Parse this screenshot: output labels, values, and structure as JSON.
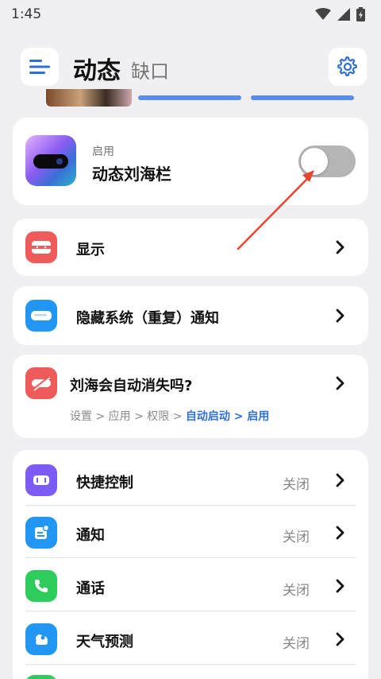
{
  "status_bar": {
    "time": "1:45",
    "icons": [
      "wifi-icon",
      "signal-icon",
      "battery-icon"
    ]
  },
  "header": {
    "title": "动态",
    "subtitle": "缺口",
    "menu_icon": "menu-icon",
    "settings_icon": "gear-icon"
  },
  "enable_card": {
    "small_label": "启用",
    "main_label": "动态刘海栏",
    "toggle_on": false
  },
  "menu": {
    "display": {
      "label": "显示"
    },
    "hide_notifications": {
      "label": "隐藏系统（重复）通知"
    },
    "auto_disappear": {
      "label": "刘海会自动消失吗?",
      "path_plain": "设置 > 应用 > 权限 > ",
      "path_highlight": "自动启动 > 启用"
    }
  },
  "features": [
    {
      "label": "快捷控制",
      "state": "关闭",
      "icon": "quick-control-icon",
      "color": "#7c5cf5"
    },
    {
      "label": "通知",
      "state": "关闭",
      "icon": "notification-icon",
      "color": "#2196f3"
    },
    {
      "label": "通话",
      "state": "关闭",
      "icon": "phone-icon",
      "color": "#2ecc5a"
    },
    {
      "label": "天气预测",
      "state": "关闭",
      "icon": "weather-icon",
      "color": "#2196f3"
    }
  ],
  "colors": {
    "accent_blue": "#2f6fd8",
    "red_icon": "#ef5b5b",
    "annotation_arrow": "#e8452c"
  }
}
